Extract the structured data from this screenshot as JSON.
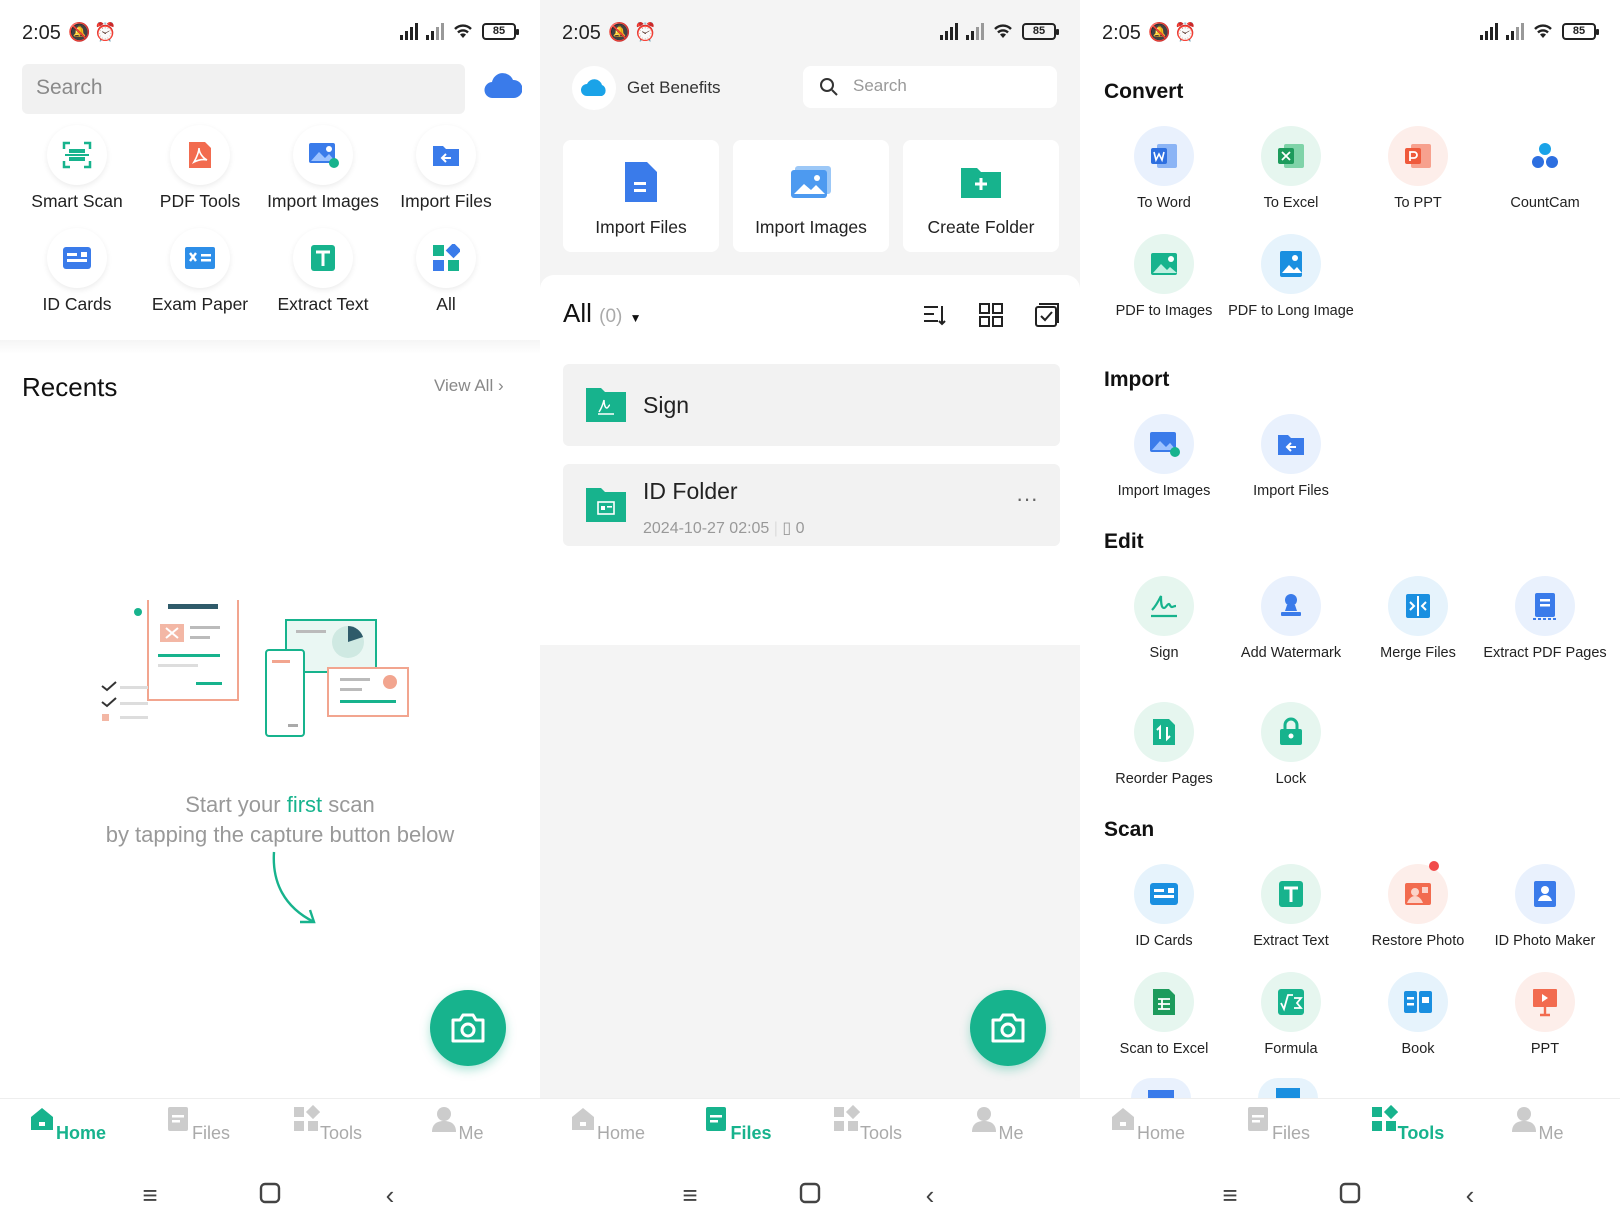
{
  "status": {
    "time": "2:05",
    "battery": "85"
  },
  "home": {
    "search_placeholder": "Search",
    "tools": [
      {
        "label": "Smart Scan",
        "icon": "smart-scan-icon"
      },
      {
        "label": "PDF Tools",
        "icon": "pdf-tools-icon"
      },
      {
        "label": "Import Images",
        "icon": "import-images-icon"
      },
      {
        "label": "Import Files",
        "icon": "import-files-icon"
      },
      {
        "label": "ID Cards",
        "icon": "id-cards-icon"
      },
      {
        "label": "Exam Paper",
        "icon": "exam-paper-icon"
      },
      {
        "label": "Extract Text",
        "icon": "extract-text-icon"
      },
      {
        "label": "All",
        "icon": "all-apps-icon"
      }
    ],
    "recents_title": "Recents",
    "view_all": "View All",
    "empty_line1_a": "Start your ",
    "empty_line1_b": "first",
    "empty_line1_c": " scan",
    "empty_line2": "by tapping the capture button below"
  },
  "files": {
    "benefits": "Get Benefits",
    "search_placeholder": "Search",
    "actions": [
      {
        "label": "Import Files"
      },
      {
        "label": "Import Images"
      },
      {
        "label": "Create Folder"
      }
    ],
    "all_label": "All",
    "all_count": "(0)",
    "folders": [
      {
        "name": "Sign"
      },
      {
        "name": "ID Folder",
        "date": "2024-10-27 02:05",
        "count": "0"
      }
    ]
  },
  "tools_page": {
    "sections": {
      "convert": "Convert",
      "import": "Import",
      "edit": "Edit",
      "scan": "Scan"
    },
    "convert": [
      "To Word",
      "To Excel",
      "To PPT",
      "CountCam",
      "PDF to Images",
      "PDF to Long Image"
    ],
    "import": [
      "Import Images",
      "Import Files"
    ],
    "edit": [
      "Sign",
      "Add Watermark",
      "Merge Files",
      "Extract PDF Pages",
      "Reorder Pages",
      "Lock"
    ],
    "scan": [
      "ID Cards",
      "Extract Text",
      "Restore Photo",
      "ID Photo Maker",
      "Scan to Excel",
      "Formula",
      "Book",
      "PPT"
    ]
  },
  "nav": {
    "home": "Home",
    "files": "Files",
    "tools": "Tools",
    "me": "Me"
  },
  "colors": {
    "accent": "#17b38d",
    "blue": "#3a7bea",
    "red": "#f26b4f"
  }
}
